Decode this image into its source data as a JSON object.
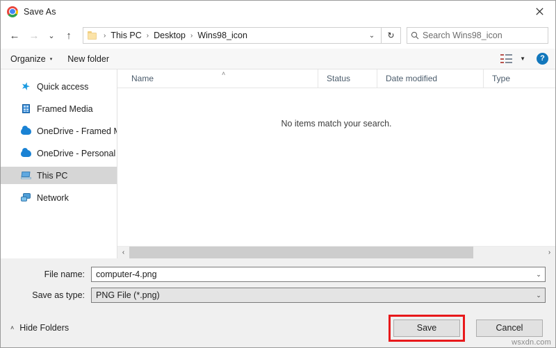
{
  "window": {
    "title": "Save As",
    "app_icon": "chrome-icon",
    "close_label": "✕"
  },
  "nav": {
    "back": "←",
    "forward": "→",
    "recent": "⌄",
    "up": "↑",
    "refresh": "↻",
    "address_chevron": "⌄",
    "breadcrumbs": [
      "This PC",
      "Desktop",
      "Wins98_icon"
    ],
    "separator": "›"
  },
  "search": {
    "placeholder": "Search Wins98_icon",
    "icon": "search-icon"
  },
  "toolbar": {
    "organize_label": "Organize",
    "organize_caret": "▾",
    "new_folder_label": "New folder",
    "view_caret": "▼",
    "help_label": "?"
  },
  "sidebar": {
    "items": [
      {
        "label": "Quick access",
        "icon": "star-icon",
        "selected": false
      },
      {
        "label": "Framed Media",
        "icon": "building-icon",
        "selected": false
      },
      {
        "label": "OneDrive - Framed M",
        "icon": "cloud-icon",
        "selected": false
      },
      {
        "label": "OneDrive - Personal",
        "icon": "cloud-icon",
        "selected": false
      },
      {
        "label": "This PC",
        "icon": "pc-icon",
        "selected": true
      },
      {
        "label": "Network",
        "icon": "network-icon",
        "selected": false
      }
    ]
  },
  "file_list": {
    "columns": [
      "Name",
      "Status",
      "Date modified",
      "Type"
    ],
    "sort_indicator": "˄",
    "rows": [],
    "empty_message": "No items match your search.",
    "scroll_left_arrow": "‹",
    "scroll_right_arrow": "›"
  },
  "fields": {
    "file_name_label": "File name:",
    "file_name_value": "computer-4.png",
    "save_as_type_label": "Save as type:",
    "save_as_type_value": "PNG File (*.png)",
    "chevron": "⌄"
  },
  "footer": {
    "hide_folders_label": "Hide Folders",
    "hide_folders_caret": "˄",
    "save_label": "Save",
    "cancel_label": "Cancel",
    "highlight_color": "#e8191b",
    "watermark": "wsxdn.com"
  }
}
